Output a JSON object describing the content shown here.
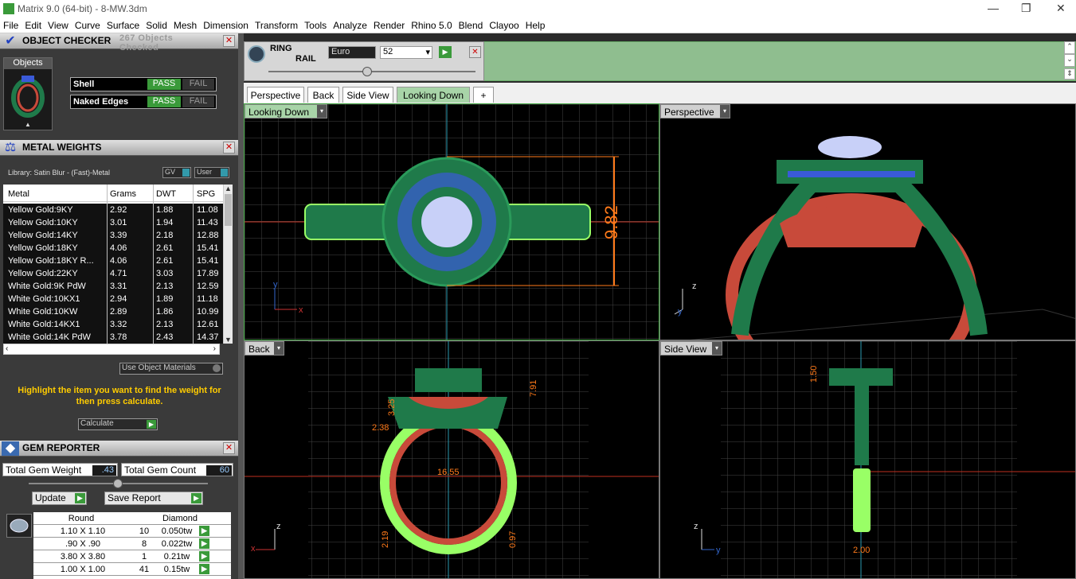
{
  "window": {
    "title": "Matrix 9.0 (64-bit) - 8-MW.3dm",
    "minimize": "—",
    "restore": "❐",
    "close": "✕"
  },
  "menu": [
    "File",
    "Edit",
    "View",
    "Curve",
    "Surface",
    "Solid",
    "Mesh",
    "Dimension",
    "Transform",
    "Tools",
    "Analyze",
    "Render",
    "Rhino 5.0",
    "Blend",
    "Clayoo",
    "Help"
  ],
  "object_checker": {
    "title": "OBJECT CHECKER",
    "count_line1": "267 Objects",
    "count_line2": "Checked",
    "objects_label": "Objects",
    "checks": [
      {
        "label": "Shell",
        "pass": "PASS",
        "fail": "FAIL"
      },
      {
        "label": "Naked Edges",
        "pass": "PASS",
        "fail": "FAIL"
      }
    ]
  },
  "metal_weights": {
    "title": "METAL WEIGHTS",
    "library": "Library: Satin Blur - (Fast)-Metal",
    "toggle_gv": "GV",
    "toggle_user": "User",
    "columns": [
      "Metal",
      "Grams",
      "DWT",
      "SPG"
    ],
    "rows": [
      [
        "Yellow Gold:9KY",
        "2.92",
        "1.88",
        "11.08"
      ],
      [
        "Yellow Gold:10KY",
        "3.01",
        "1.94",
        "11.43"
      ],
      [
        "Yellow Gold:14KY",
        "3.39",
        "2.18",
        "12.88"
      ],
      [
        "Yellow Gold:18KY",
        "4.06",
        "2.61",
        "15.41"
      ],
      [
        "Yellow Gold:18KY R...",
        "4.06",
        "2.61",
        "15.41"
      ],
      [
        "Yellow Gold:22KY",
        "4.71",
        "3.03",
        "17.89"
      ],
      [
        "White Gold:9K PdW",
        "3.31",
        "2.13",
        "12.59"
      ],
      [
        "White Gold:10KX1",
        "2.94",
        "1.89",
        "11.18"
      ],
      [
        "White Gold:10KW",
        "2.89",
        "1.86",
        "10.99"
      ],
      [
        "White Gold:14KX1",
        "3.32",
        "2.13",
        "12.61"
      ],
      [
        "White Gold:14K PdW",
        "3.78",
        "2.43",
        "14.37"
      ]
    ],
    "use_object_materials": "Use Object Materials",
    "hint": "Highlight the item you want to find the weight for then press calculate.",
    "calculate": "Calculate"
  },
  "gem_reporter": {
    "title": "GEM REPORTER",
    "total_weight_label": "Total Gem Weight",
    "total_weight": ".43",
    "total_count_label": "Total Gem Count",
    "total_count": "60",
    "update": "Update",
    "save_report": "Save Report",
    "col_shape": "Round",
    "col_type": "Diamond",
    "rows": [
      [
        "1.10 X 1.10",
        "10",
        "0.050tw"
      ],
      [
        ".90 X .90",
        "8",
        "0.022tw"
      ],
      [
        "3.80 X 3.80",
        "1",
        "0.21tw"
      ],
      [
        "1.00 X 1.00",
        "41",
        "0.15tw"
      ]
    ]
  },
  "ring_rail": {
    "title_line1": "RING",
    "title_line2": "RAIL",
    "standard": "Euro",
    "size": "52"
  },
  "tabs": [
    "Perspective",
    "Back",
    "Side View",
    "Looking Down",
    "+"
  ],
  "active_tab": "Looking Down",
  "viewports": {
    "top_left": {
      "label": "Looking Down",
      "dim": "9.82",
      "axis_y": "y",
      "axis_x": "x"
    },
    "top_right": {
      "label": "Perspective",
      "axis_z": "z",
      "axis_y": "y"
    },
    "bottom_left": {
      "label": "Back",
      "dim_a": "7.91",
      "dim_b": "3.25",
      "dim_c": "2.38",
      "dim_d": "16.55",
      "dim_e": "2.19",
      "dim_f": "0.97",
      "axis_z": "z",
      "axis_x": "x"
    },
    "bottom_right": {
      "label": "Side View",
      "dim_a": "1.50",
      "dim_b": "2.00",
      "axis_z": "z",
      "axis_y": "y"
    }
  },
  "colors": {
    "green_accent": "#3a9a3a",
    "ring_green": "#1f7a4a",
    "ring_red": "#c84a3a",
    "gem_blue": "#3a5ad8",
    "dimension_orange": "#ff7a1a",
    "hint_yellow": "#ffcc00"
  }
}
